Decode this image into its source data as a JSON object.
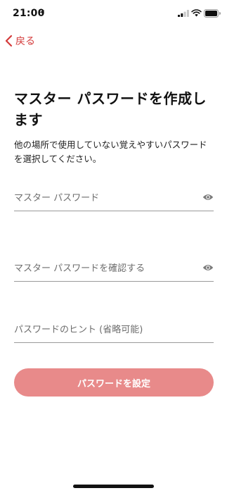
{
  "status_bar": {
    "time": "21:00"
  },
  "nav": {
    "back_label": "戻る"
  },
  "page": {
    "title": "マスター パスワードを作成します",
    "description": "他の場所で使用していない覚えやすいパスワードを選択してください。"
  },
  "form": {
    "master_password_placeholder": "マスター パスワード",
    "master_password_value": "",
    "confirm_password_placeholder": "マスター パスワードを確認する",
    "confirm_password_value": "",
    "hint_placeholder": "パスワードのヒント (省略可能)",
    "hint_value": "",
    "submit_label": "パスワードを設定"
  },
  "colors": {
    "accent": "#d43b3b",
    "button_disabled": "#e88a8a",
    "field_underline": "#9a9a9a",
    "placeholder": "#6d6d6d"
  },
  "icons": {
    "status": [
      "location-arrow-icon",
      "signal-icon",
      "wifi-icon",
      "battery-icon"
    ],
    "back": "chevron-left-icon",
    "password_toggle": "eye-icon"
  }
}
